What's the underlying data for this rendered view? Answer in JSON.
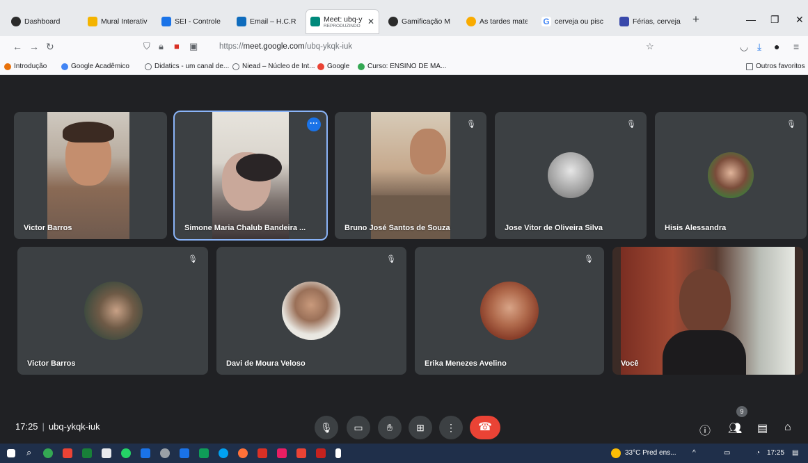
{
  "tabs": [
    {
      "title": "Dashboard",
      "color": "#2b2b2b"
    },
    {
      "title": "Mural Interativo",
      "color": "#f4b400"
    },
    {
      "title": "SEI - Controle d",
      "color": "#1a73e8"
    },
    {
      "title": "Email – H.C.R.C",
      "color": "#0f6cbd"
    },
    {
      "title": "Meet: ubq-yk",
      "subtitle": "REPRODUZINDO",
      "color": "#00897b",
      "active": true
    },
    {
      "title": "Gamificação M",
      "color": "#2b2b2b"
    },
    {
      "title": "As tardes mate",
      "color": "#f9ab00"
    },
    {
      "title": "cerveja ou pisc",
      "color": "#4285f4"
    },
    {
      "title": "Férias, cerveja",
      "color": "#3949ab"
    }
  ],
  "browser": {
    "url_prefix": "https://",
    "url_domain": "meet.google.com",
    "url_path": "/ubq-ykqk-iuk"
  },
  "bookmarks": [
    {
      "label": "Introdução",
      "color": "#e8710a"
    },
    {
      "label": "Google Acadêmico",
      "color": "#4285f4"
    },
    {
      "label": "Didatics - um canal de...",
      "color": "#5f6368"
    },
    {
      "label": "Niead – Núcleo de Int...",
      "color": "#5f6368"
    },
    {
      "label": "Google",
      "color": "#ea4335"
    },
    {
      "label": "Curso: ENSINO DE MA...",
      "color": "#34a853"
    },
    {
      "label": "Outros favoritos",
      "color": "#5f6368"
    }
  ],
  "participants": [
    {
      "name": "Victor Barros",
      "kind": "video"
    },
    {
      "name": "Simone Maria Chalub Bandeira ...",
      "kind": "video",
      "speaking": true
    },
    {
      "name": "Bruno José Santos de Souza",
      "kind": "video",
      "muted": true
    },
    {
      "name": "Jose Vitor de Oliveira Silva",
      "kind": "avatar",
      "muted": true
    },
    {
      "name": "Hisis Alessandra",
      "kind": "avatar",
      "muted": true
    },
    {
      "name": "Victor Barros",
      "kind": "avatar",
      "muted": true
    },
    {
      "name": "Davi de Moura Veloso",
      "kind": "avatar",
      "muted": true
    },
    {
      "name": "Erika Menezes Avelino",
      "kind": "avatar",
      "muted": true
    },
    {
      "name": "Você",
      "kind": "video"
    }
  ],
  "meeting": {
    "time": "17:25",
    "code": "ubq-ykqk-iuk",
    "participant_count": "9"
  },
  "taskbar": {
    "weather": "33°C  Pred ens...",
    "clock": "17:25"
  },
  "colors": {
    "meet_bg": "#202124",
    "tile_bg": "#3c4043",
    "speaking_border": "#8ab4f8",
    "end_call": "#ea4335"
  }
}
